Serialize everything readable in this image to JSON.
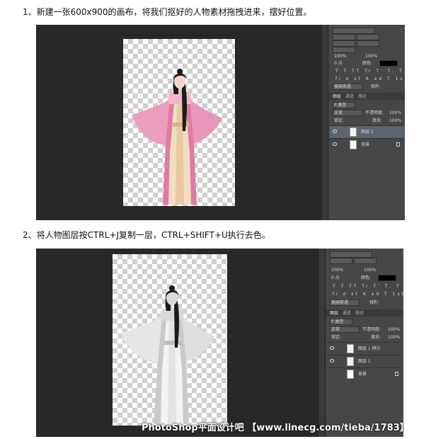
{
  "steps": [
    {
      "number": "1、",
      "text": "新建一张600x900的画布，将我们抠好的人物素材拖拽进来，摆好位置。",
      "panel": {
        "tabs": [
          "图层",
          "通道",
          "路径"
        ],
        "filter_label": "P 类型",
        "blend_mode": "正常",
        "opacity_label": "不透明度:",
        "opacity_value": "100%",
        "lock_label": "锁定:",
        "fill_label": "填充:",
        "fill_value": "100%",
        "char_size_1": "100%",
        "char_size_2": "100%",
        "char_tracking": "0 点",
        "char_color_label": "颜色:",
        "lang_value": "美国英语",
        "aa_value": "锐利",
        "layers": [
          {
            "name": "图层 1",
            "selected": true,
            "type": "image"
          },
          {
            "name": "背景",
            "selected": false,
            "type": "background"
          }
        ]
      }
    },
    {
      "number": "2、",
      "text": "将人物图层按CTRL+J复制一层，CTRL+SHIFT+U执行去色。",
      "panel": {
        "tabs": [
          "图层",
          "通道",
          "路径"
        ],
        "filter_label": "P 类型",
        "blend_mode": "正常",
        "opacity_label": "不透明度:",
        "opacity_value": "100%",
        "lock_label": "锁定:",
        "fill_label": "填充:",
        "fill_value": "100%",
        "char_size_1": "100%",
        "char_size_2": "100%",
        "char_tracking": "0 点",
        "char_color_label": "颜色:",
        "lang_value": "美国英语",
        "aa_value": "锐利",
        "layers": [
          {
            "name": "图层 1 拷贝",
            "selected": false,
            "type": "image"
          },
          {
            "name": "图层 1",
            "selected": false,
            "type": "image"
          },
          {
            "name": "背景",
            "selected": false,
            "type": "background"
          }
        ]
      }
    }
  ],
  "watermark": "PhotoShop平面设计吧 【www.linecg.com/tieba/1783】",
  "colors": {
    "workspace": "#282828",
    "panel": "#474747",
    "robe_pink": "#e98fb5",
    "robe_cream": "#f1dcc0",
    "hair": "#1a1a1a"
  }
}
